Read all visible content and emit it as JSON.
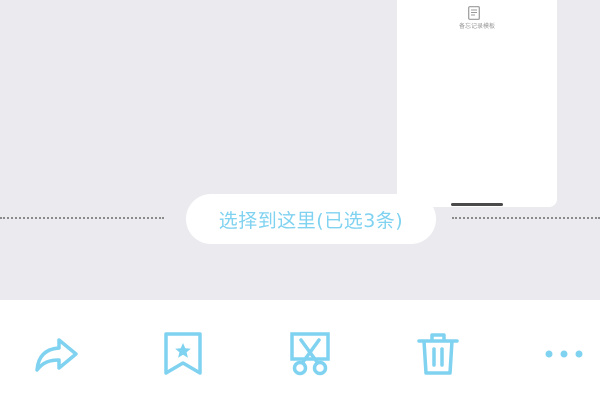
{
  "chat": {
    "card_caption": "备忘记录模板",
    "selection_pill": "选择到这里(已选3条)"
  },
  "toolbar": {
    "actions": [
      {
        "name": "forward",
        "icon": "forward-arrow-icon"
      },
      {
        "name": "favorite",
        "icon": "bookmark-star-icon"
      },
      {
        "name": "cut",
        "icon": "scissors-icon"
      },
      {
        "name": "delete",
        "icon": "trash-icon"
      },
      {
        "name": "more",
        "icon": "more-dots-icon"
      }
    ]
  },
  "colors": {
    "accent": "#7fd2f0",
    "background": "#ebebef",
    "surface": "#ffffff",
    "muted_text": "#9a9a9a"
  }
}
